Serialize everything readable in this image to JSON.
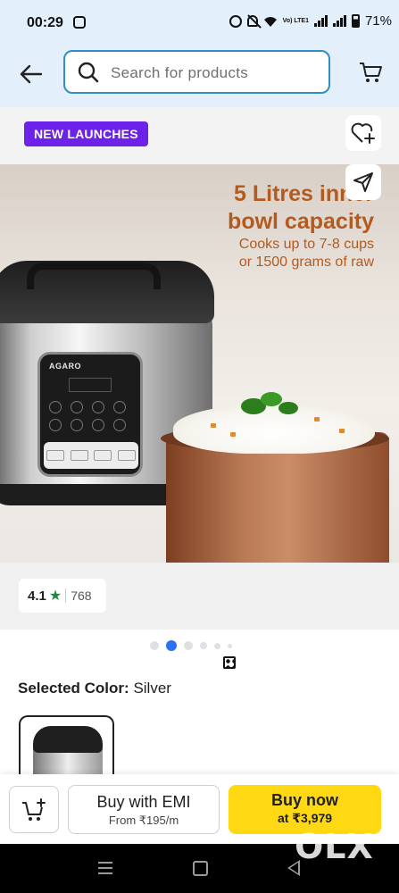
{
  "status_bar": {
    "time": "00:29",
    "volte_label": "Vo) LTE1",
    "battery_percent": "71%"
  },
  "header": {
    "search": {
      "placeholder": "Search for products"
    },
    "icons": {
      "back": "back-arrow-icon",
      "cart": "cart-icon"
    }
  },
  "gallery": {
    "badge": "NEW LAUNCHES",
    "icons": {
      "wishlist": "heart-plus-icon",
      "share": "share-icon"
    },
    "image": {
      "brand": "AGARO",
      "headline_line1": "5 Litres inner",
      "headline_line2": "bowl capacity",
      "sub_line1": "Cooks up to 7-8 cups",
      "sub_line2": "or 1500 grams of raw",
      "text_color": "#b35a1f"
    },
    "rating": {
      "value": "4.1",
      "star": "★",
      "count": "768",
      "star_color": "#1f8a3e"
    },
    "pager": {
      "total": 6,
      "active_index": 1,
      "accent": "#2874f0"
    }
  },
  "selected_color": {
    "label": "Selected Color:",
    "value": "Silver"
  },
  "actions": {
    "add_to_cart_icon": "cart-plus-icon",
    "emi_title": "Buy with EMI",
    "emi_sub": "From ₹195/m",
    "buy_title": "Buy now",
    "buy_sub": "at ₹3,979",
    "buy_color": "#ffd814"
  },
  "watermark": "OLX",
  "nav": {
    "icons": [
      "menu-icon",
      "home-icon",
      "back-icon"
    ]
  }
}
